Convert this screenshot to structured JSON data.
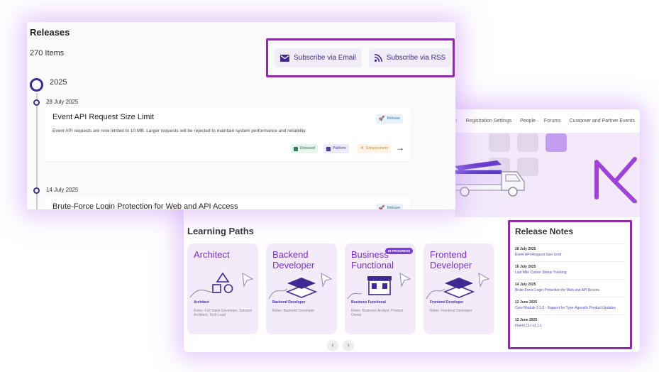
{
  "releases": {
    "title": "Releases",
    "count": "270 Items",
    "subscribe_email": "Subscribe via Email",
    "subscribe_rss": "Subscribe via RSS",
    "year": "2025",
    "entries": [
      {
        "date": "28 July 2025",
        "title": "Event API Request Size Limit",
        "description": "Event API requests are now limited to 10 MB. Larger requests will be rejected to maintain system performance and reliability.",
        "release_tag": "Release",
        "status_tag": "Released",
        "area_tag": "Platform",
        "type_tag": "Enhancement"
      },
      {
        "date": "14 July 2025",
        "title": "Brute-Force Login Protection for Web and API Access",
        "release_tag": "Release"
      }
    ]
  },
  "portal": {
    "nav": [
      "Registration Settings",
      "People",
      "Forums",
      "Customer and Partner Events"
    ],
    "learning_paths_title": "Learning Paths",
    "paths": [
      {
        "name": "Architect",
        "role": "Architect",
        "roles": "Roles: Full Stack Developer, Solution Architect, Tech Lead"
      },
      {
        "name": "Backend Developer",
        "role": "Backend Developer",
        "roles": "Roles: Backend Developer"
      },
      {
        "name": "Business Functional",
        "role": "Business Functional",
        "roles": "Roles: Business Analyst, Product Owner",
        "badge": "IN PROGRESS"
      },
      {
        "name": "Frontend Developer",
        "role": "Frontend Developer",
        "roles": "Roles: Frontend Developer"
      }
    ],
    "release_notes_title": "Release Notes",
    "release_notes": [
      {
        "date": "28 July 2025",
        "title": "Event API Request Size Limit"
      },
      {
        "date": "16 July 2025",
        "title": "Last Mile Carrier Status Tracking"
      },
      {
        "date": "14 July 2025",
        "title": "Brute-Force Login Protection for Web and API Access"
      },
      {
        "date": "12 June 2025",
        "title": "Core Module 2.1.0 - Support for Type-Agnostic Product Updates"
      },
      {
        "date": "12 June 2025",
        "title": "Fluent CLI v1.1.1"
      }
    ]
  },
  "colors": {
    "accent": "#8e2ca3",
    "brand_purple": "#3e2a92",
    "link": "#4848c8"
  }
}
